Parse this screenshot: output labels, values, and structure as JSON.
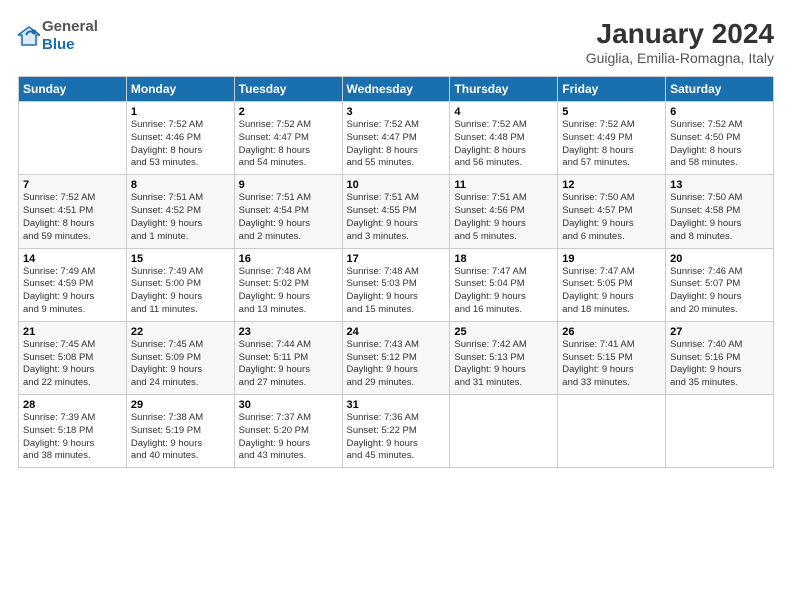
{
  "logo": {
    "general": "General",
    "blue": "Blue"
  },
  "title": "January 2024",
  "subtitle": "Guiglia, Emilia-Romagna, Italy",
  "calendar": {
    "headers": [
      "Sunday",
      "Monday",
      "Tuesday",
      "Wednesday",
      "Thursday",
      "Friday",
      "Saturday"
    ],
    "weeks": [
      [
        {
          "day": "",
          "info": ""
        },
        {
          "day": "1",
          "info": "Sunrise: 7:52 AM\nSunset: 4:46 PM\nDaylight: 8 hours\nand 53 minutes."
        },
        {
          "day": "2",
          "info": "Sunrise: 7:52 AM\nSunset: 4:47 PM\nDaylight: 8 hours\nand 54 minutes."
        },
        {
          "day": "3",
          "info": "Sunrise: 7:52 AM\nSunset: 4:47 PM\nDaylight: 8 hours\nand 55 minutes."
        },
        {
          "day": "4",
          "info": "Sunrise: 7:52 AM\nSunset: 4:48 PM\nDaylight: 8 hours\nand 56 minutes."
        },
        {
          "day": "5",
          "info": "Sunrise: 7:52 AM\nSunset: 4:49 PM\nDaylight: 8 hours\nand 57 minutes."
        },
        {
          "day": "6",
          "info": "Sunrise: 7:52 AM\nSunset: 4:50 PM\nDaylight: 8 hours\nand 58 minutes."
        }
      ],
      [
        {
          "day": "7",
          "info": "Sunrise: 7:52 AM\nSunset: 4:51 PM\nDaylight: 8 hours\nand 59 minutes."
        },
        {
          "day": "8",
          "info": "Sunrise: 7:51 AM\nSunset: 4:52 PM\nDaylight: 9 hours\nand 1 minute."
        },
        {
          "day": "9",
          "info": "Sunrise: 7:51 AM\nSunset: 4:54 PM\nDaylight: 9 hours\nand 2 minutes."
        },
        {
          "day": "10",
          "info": "Sunrise: 7:51 AM\nSunset: 4:55 PM\nDaylight: 9 hours\nand 3 minutes."
        },
        {
          "day": "11",
          "info": "Sunrise: 7:51 AM\nSunset: 4:56 PM\nDaylight: 9 hours\nand 5 minutes."
        },
        {
          "day": "12",
          "info": "Sunrise: 7:50 AM\nSunset: 4:57 PM\nDaylight: 9 hours\nand 6 minutes."
        },
        {
          "day": "13",
          "info": "Sunrise: 7:50 AM\nSunset: 4:58 PM\nDaylight: 9 hours\nand 8 minutes."
        }
      ],
      [
        {
          "day": "14",
          "info": "Sunrise: 7:49 AM\nSunset: 4:59 PM\nDaylight: 9 hours\nand 9 minutes."
        },
        {
          "day": "15",
          "info": "Sunrise: 7:49 AM\nSunset: 5:00 PM\nDaylight: 9 hours\nand 11 minutes."
        },
        {
          "day": "16",
          "info": "Sunrise: 7:48 AM\nSunset: 5:02 PM\nDaylight: 9 hours\nand 13 minutes."
        },
        {
          "day": "17",
          "info": "Sunrise: 7:48 AM\nSunset: 5:03 PM\nDaylight: 9 hours\nand 15 minutes."
        },
        {
          "day": "18",
          "info": "Sunrise: 7:47 AM\nSunset: 5:04 PM\nDaylight: 9 hours\nand 16 minutes."
        },
        {
          "day": "19",
          "info": "Sunrise: 7:47 AM\nSunset: 5:05 PM\nDaylight: 9 hours\nand 18 minutes."
        },
        {
          "day": "20",
          "info": "Sunrise: 7:46 AM\nSunset: 5:07 PM\nDaylight: 9 hours\nand 20 minutes."
        }
      ],
      [
        {
          "day": "21",
          "info": "Sunrise: 7:45 AM\nSunset: 5:08 PM\nDaylight: 9 hours\nand 22 minutes."
        },
        {
          "day": "22",
          "info": "Sunrise: 7:45 AM\nSunset: 5:09 PM\nDaylight: 9 hours\nand 24 minutes."
        },
        {
          "day": "23",
          "info": "Sunrise: 7:44 AM\nSunset: 5:11 PM\nDaylight: 9 hours\nand 27 minutes."
        },
        {
          "day": "24",
          "info": "Sunrise: 7:43 AM\nSunset: 5:12 PM\nDaylight: 9 hours\nand 29 minutes."
        },
        {
          "day": "25",
          "info": "Sunrise: 7:42 AM\nSunset: 5:13 PM\nDaylight: 9 hours\nand 31 minutes."
        },
        {
          "day": "26",
          "info": "Sunrise: 7:41 AM\nSunset: 5:15 PM\nDaylight: 9 hours\nand 33 minutes."
        },
        {
          "day": "27",
          "info": "Sunrise: 7:40 AM\nSunset: 5:16 PM\nDaylight: 9 hours\nand 35 minutes."
        }
      ],
      [
        {
          "day": "28",
          "info": "Sunrise: 7:39 AM\nSunset: 5:18 PM\nDaylight: 9 hours\nand 38 minutes."
        },
        {
          "day": "29",
          "info": "Sunrise: 7:38 AM\nSunset: 5:19 PM\nDaylight: 9 hours\nand 40 minutes."
        },
        {
          "day": "30",
          "info": "Sunrise: 7:37 AM\nSunset: 5:20 PM\nDaylight: 9 hours\nand 43 minutes."
        },
        {
          "day": "31",
          "info": "Sunrise: 7:36 AM\nSunset: 5:22 PM\nDaylight: 9 hours\nand 45 minutes."
        },
        {
          "day": "",
          "info": ""
        },
        {
          "day": "",
          "info": ""
        },
        {
          "day": "",
          "info": ""
        }
      ]
    ]
  }
}
